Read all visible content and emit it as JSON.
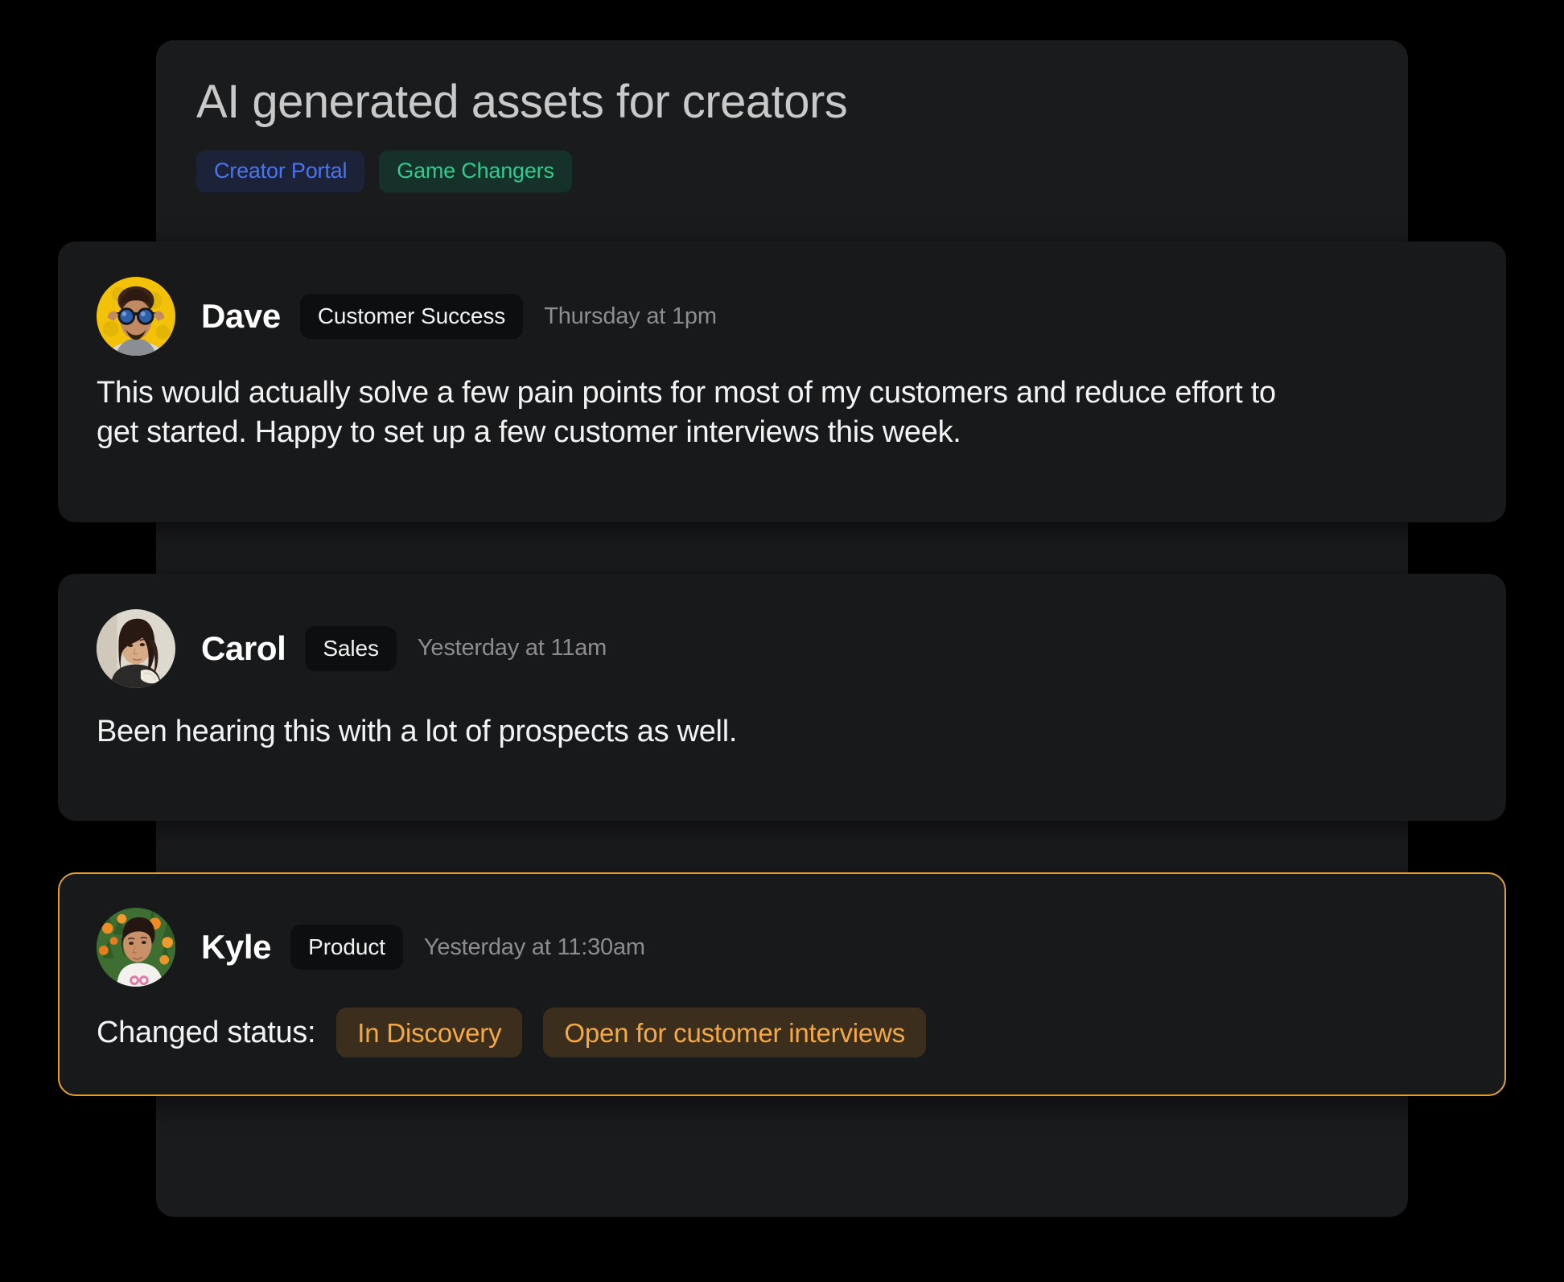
{
  "panel": {
    "title": "AI generated assets for creators",
    "tags": [
      {
        "label": "Creator Portal",
        "color": "#4a74ee",
        "background": "#1c2339"
      },
      {
        "label": "Game Changers",
        "color": "#2ecc8e",
        "background": "#16312a"
      }
    ]
  },
  "messages": [
    {
      "author": "Dave",
      "role": "Customer Success",
      "timestamp": "Thursday at 1pm",
      "body": "This would actually solve a few pain points for most of my customers and reduce effort to get started.  Happy to set up a few customer interviews this week.",
      "avatar": "avatar-dave-sunglasses-yellow",
      "highlighted": false
    },
    {
      "author": "Carol",
      "role": "Sales",
      "timestamp": "Yesterday at 11am",
      "body": "Been hearing this with a lot of prospects as well.",
      "avatar": "avatar-carol-portrait-beige",
      "highlighted": false
    },
    {
      "author": "Kyle",
      "role": "Product",
      "timestamp": "Yesterday at 11:30am",
      "avatar": "avatar-kyle-flowers-green",
      "highlighted": true,
      "status_change": {
        "label": "Changed status:",
        "from": "In Discovery",
        "to": "Open for customer interviews",
        "chip_color": "#f5a944",
        "chip_background": "#3b2e1c"
      }
    }
  ],
  "colors": {
    "page_background": "#000000",
    "panel_background": "#1a1b1d",
    "card_background": "#18191b",
    "highlight_border": "#dfa03a",
    "title_text": "#c9c9c9",
    "body_text": "#f3f3f3",
    "muted_text": "#8d8d8f"
  }
}
